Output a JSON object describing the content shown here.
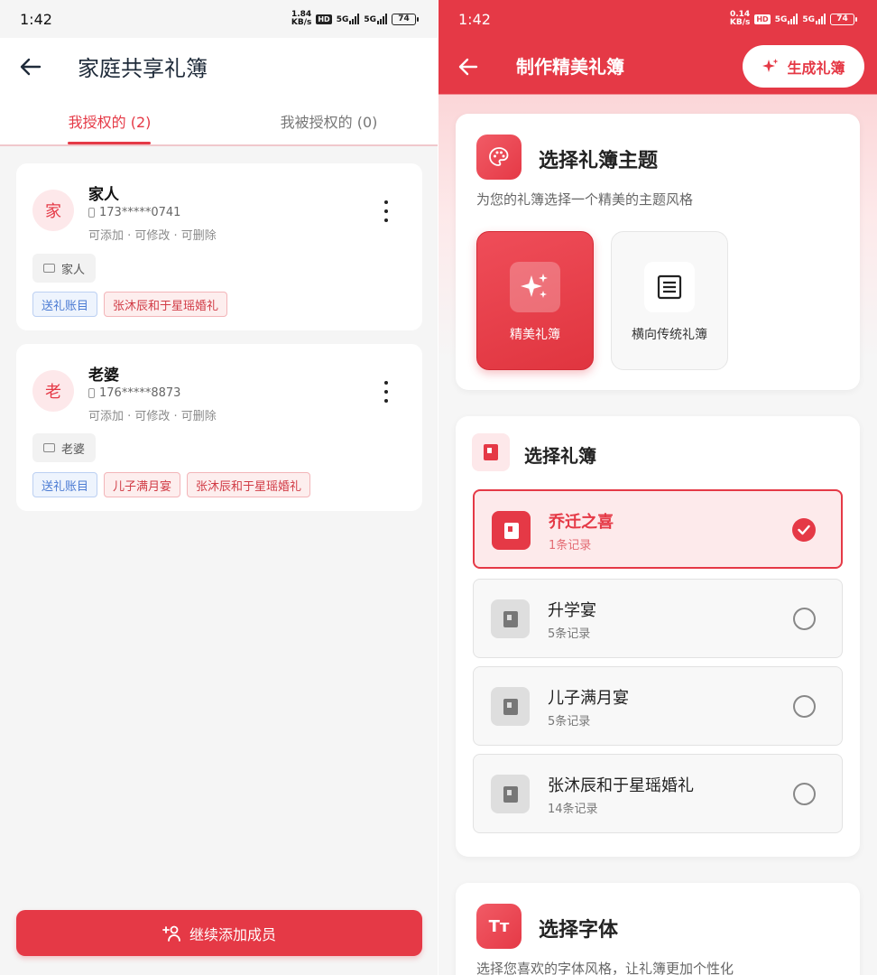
{
  "left": {
    "status": {
      "time": "1:42",
      "speed_top": "1.84",
      "speed_bottom": "KB/s",
      "hd": "HD",
      "net1": "5G",
      "net2": "5G",
      "battery": "74"
    },
    "header": {
      "title": "家庭共享礼簿"
    },
    "tabs": [
      {
        "label": "我授权的 (2)"
      },
      {
        "label": "我被授权的 (0)"
      }
    ],
    "members": [
      {
        "avatar": "家",
        "name": "家人",
        "phone": "173*****0741",
        "perms": "可添加 · 可修改 · 可删除",
        "group": "家人",
        "tags": [
          "送礼账目",
          "张沐辰和于星瑶婚礼"
        ]
      },
      {
        "avatar": "老",
        "name": "老婆",
        "phone": "176*****8873",
        "perms": "可添加 · 可修改 · 可删除",
        "group": "老婆",
        "tags": [
          "送礼账目",
          "儿子满月宴",
          "张沐辰和于星瑶婚礼"
        ]
      }
    ],
    "add_button": "继续添加成员",
    "colors": {
      "accent": "#e53946"
    }
  },
  "right": {
    "status": {
      "time": "1:42",
      "speed_top": "0.14",
      "speed_bottom": "KB/s",
      "hd": "HD",
      "net1": "5G",
      "net2": "5G",
      "battery": "74"
    },
    "header": {
      "title": "制作精美礼簿",
      "generate_button": "生成礼簿"
    },
    "theme_section": {
      "title": "选择礼簿主题",
      "subtitle": "为您的礼簿选择一个精美的主题风格",
      "options": [
        {
          "label": "精美礼簿",
          "icon": "sparkle-icon"
        },
        {
          "label": "横向传统礼簿",
          "icon": "document-icon"
        }
      ]
    },
    "book_section": {
      "title": "选择礼簿",
      "books": [
        {
          "name": "乔迁之喜",
          "count": "1条记录"
        },
        {
          "name": "升学宴",
          "count": "5条记录"
        },
        {
          "name": "儿子满月宴",
          "count": "5条记录"
        },
        {
          "name": "张沐辰和于星瑶婚礼",
          "count": "14条记录"
        }
      ]
    },
    "font_section": {
      "title": "选择字体",
      "icon_text": "Tт",
      "subtitle": "选择您喜欢的字体风格，让礼簿更加个性化"
    }
  }
}
